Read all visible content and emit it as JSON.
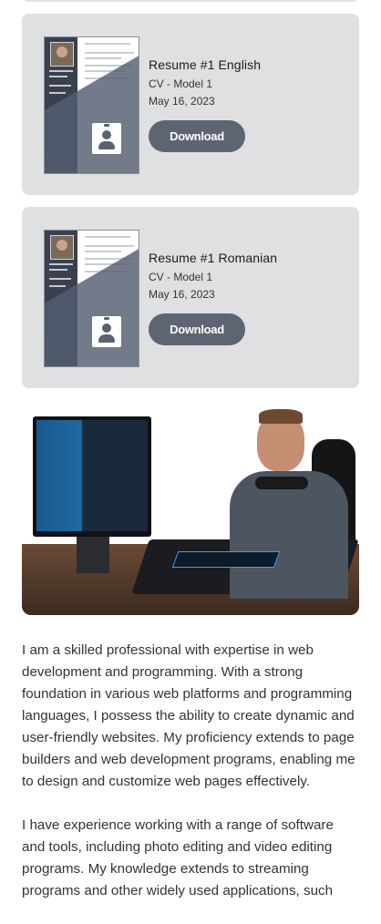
{
  "resumes": [
    {
      "title": "Resume #1 English",
      "model": "CV - Model 1",
      "date": "May 16, 2023",
      "download_label": "Download"
    },
    {
      "title": "Resume #1 Romanian",
      "model": "CV - Model 1",
      "date": "May 16, 2023",
      "download_label": "Download"
    }
  ],
  "icons": {
    "resume_badge": "id-badge-icon"
  },
  "colors": {
    "card_bg": "#dfe0e2",
    "button_bg": "#5e6572",
    "button_text": "#ffffff",
    "text": "#333333"
  },
  "about": {
    "paragraph_1": "I am a skilled professional with expertise in web development and programming. With a strong foundation in various web platforms and programming languages, I possess the ability to create dynamic and user-friendly websites. My proficiency extends to page builders and web development programs, enabling me to design and customize web pages effectively.",
    "paragraph_2": "I have experience working with a range of software and tools, including photo editing and video editing programs. My knowledge extends to streaming programs and other widely used applications, such"
  }
}
